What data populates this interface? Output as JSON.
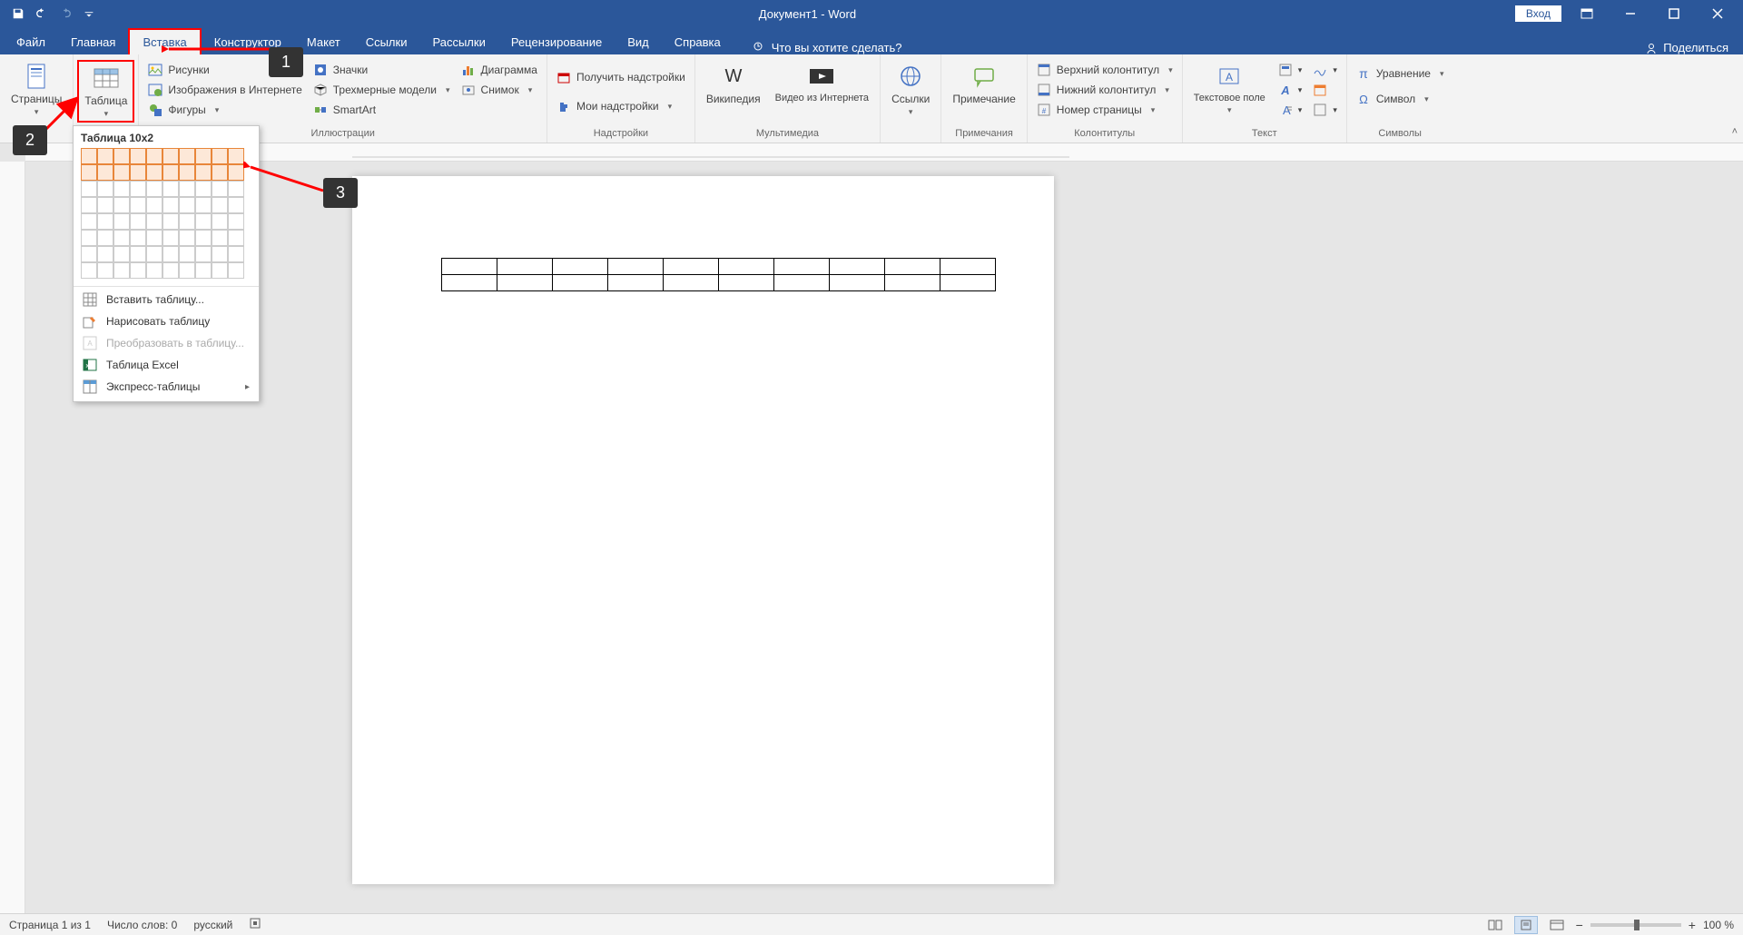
{
  "title": "Документ1 - Word",
  "login": "Вход",
  "tabs": {
    "file": "Файл",
    "home": "Главная",
    "insert": "Вставка",
    "design": "Конструктор",
    "layout": "Макет",
    "references": "Ссылки",
    "mailings": "Рассылки",
    "review": "Рецензирование",
    "view": "Вид",
    "help": "Справка",
    "tellme": "Что вы хотите сделать?",
    "share": "Поделиться"
  },
  "ribbon": {
    "pages": {
      "label": "Страницы"
    },
    "table": {
      "btn": "Таблица"
    },
    "illustrations": {
      "label": "Иллюстрации",
      "pictures": "Рисунки",
      "online": "Изображения в Интернете",
      "shapes": "Фигуры",
      "icons": "Значки",
      "models3d": "Трехмерные модели",
      "smartart": "SmartArt",
      "chart": "Диаграмма",
      "screenshot": "Снимок"
    },
    "addins": {
      "label": "Надстройки",
      "get": "Получить надстройки",
      "my": "Мои надстройки"
    },
    "media": {
      "label": "Мультимедиа",
      "wiki": "Википедия",
      "video": "Видео из Интернета"
    },
    "links": {
      "label": "",
      "btn": "Ссылки"
    },
    "comments": {
      "label": "Примечания",
      "btn": "Примечание"
    },
    "headerfooter": {
      "label": "Колонтитулы",
      "header": "Верхний колонтитул",
      "footer": "Нижний колонтитул",
      "page": "Номер страницы"
    },
    "text": {
      "label": "Текст",
      "textbox": "Текстовое поле"
    },
    "symbols": {
      "label": "Символы",
      "eq": "Уравнение",
      "sym": "Символ"
    }
  },
  "dropdown": {
    "header": "Таблица 10x2",
    "insert": "Вставить таблицу...",
    "draw": "Нарисовать таблицу",
    "convert": "Преобразовать в таблицу...",
    "excel": "Таблица Excel",
    "quick": "Экспресс-таблицы",
    "grid": {
      "cols": 10,
      "rows": 8,
      "sel_cols": 10,
      "sel_rows": 2
    }
  },
  "callouts": {
    "c1": "1",
    "c2": "2",
    "c3": "3"
  },
  "statusbar": {
    "page": "Страница 1 из 1",
    "words": "Число слов: 0",
    "lang": "русский",
    "zoom": "100 %",
    "minus": "−",
    "plus": "+"
  },
  "doc_table": {
    "rows": 2,
    "cols": 10
  }
}
